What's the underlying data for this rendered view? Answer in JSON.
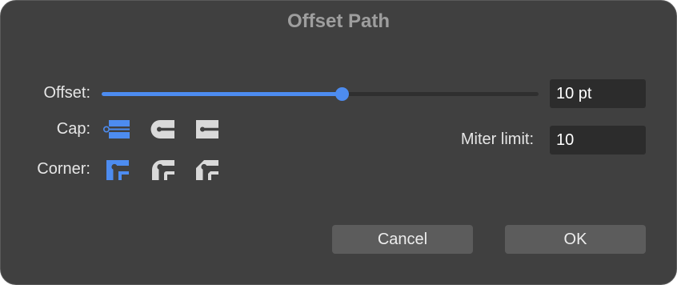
{
  "dialog": {
    "title": "Offset Path"
  },
  "offset": {
    "label": "Offset:",
    "slider_fraction": 0.549,
    "value": "10 pt"
  },
  "cap": {
    "label": "Cap:",
    "options": [
      {
        "name": "butt-cap",
        "selected": true
      },
      {
        "name": "round-cap",
        "selected": false
      },
      {
        "name": "projecting-cap",
        "selected": false
      }
    ]
  },
  "corner": {
    "label": "Corner:",
    "options": [
      {
        "name": "miter-join",
        "selected": true
      },
      {
        "name": "round-join",
        "selected": false
      },
      {
        "name": "bevel-join",
        "selected": false
      }
    ]
  },
  "miter": {
    "label": "Miter limit:",
    "value": "10"
  },
  "buttons": {
    "cancel": "Cancel",
    "ok": "OK"
  },
  "colors": {
    "accent": "#4d8cf0",
    "icon_inactive": "#d9d9d9",
    "background": "#404040"
  }
}
